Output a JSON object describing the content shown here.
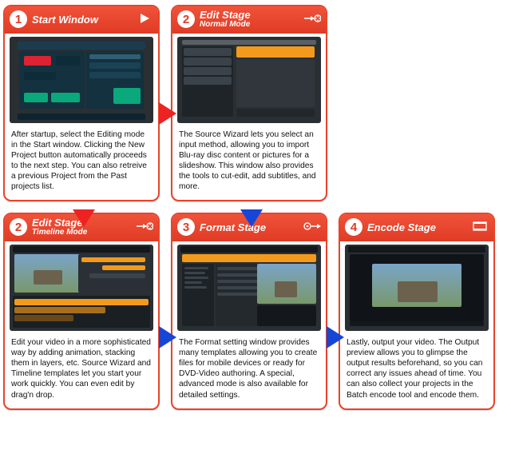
{
  "cards": [
    {
      "num": "1",
      "title": "Start Window",
      "subtitle": "",
      "icon": "play-icon",
      "desc": "After startup, select the Editing mode in the Start window. Clicking the New Project button automatically proceeds to the next step. You can also retreive a previous Project from the Past projects list."
    },
    {
      "num": "2",
      "title": "Edit Stage",
      "subtitle": "Normal Mode",
      "icon": "reel-arrow-icon",
      "desc": "The Source Wizard lets you select an input method, allowing you to import Blu-ray disc content or pictures for a slideshow. This window also provides the tools to cut-edit, add subtitles, and more."
    },
    {
      "num": "2",
      "title": "Edit Stage",
      "subtitle": "Timeline Mode",
      "icon": "reel-arrow-icon",
      "desc": "Edit your video in a more sophisticated way by adding animation, stacking them in layers, etc. Source Wizard and Timeline templates let you start your work quickly. You can even edit by drag'n drop."
    },
    {
      "num": "3",
      "title": "Format Stage",
      "subtitle": "",
      "icon": "gear-arrow-icon",
      "desc": "The Format setting window provides many templates allowing you to create files for mobile devices or ready for DVD-Video authoring. A special, advanced mode is also available for detailed settings."
    },
    {
      "num": "4",
      "title": "Encode Stage",
      "subtitle": "",
      "icon": "filmstrip-icon",
      "desc": "Lastly, output your video. The Output preview allows you to glimpse the output results beforehand, so you can correct any issues ahead of time. You can also collect your projects in the Batch encode tool and encode them."
    }
  ]
}
